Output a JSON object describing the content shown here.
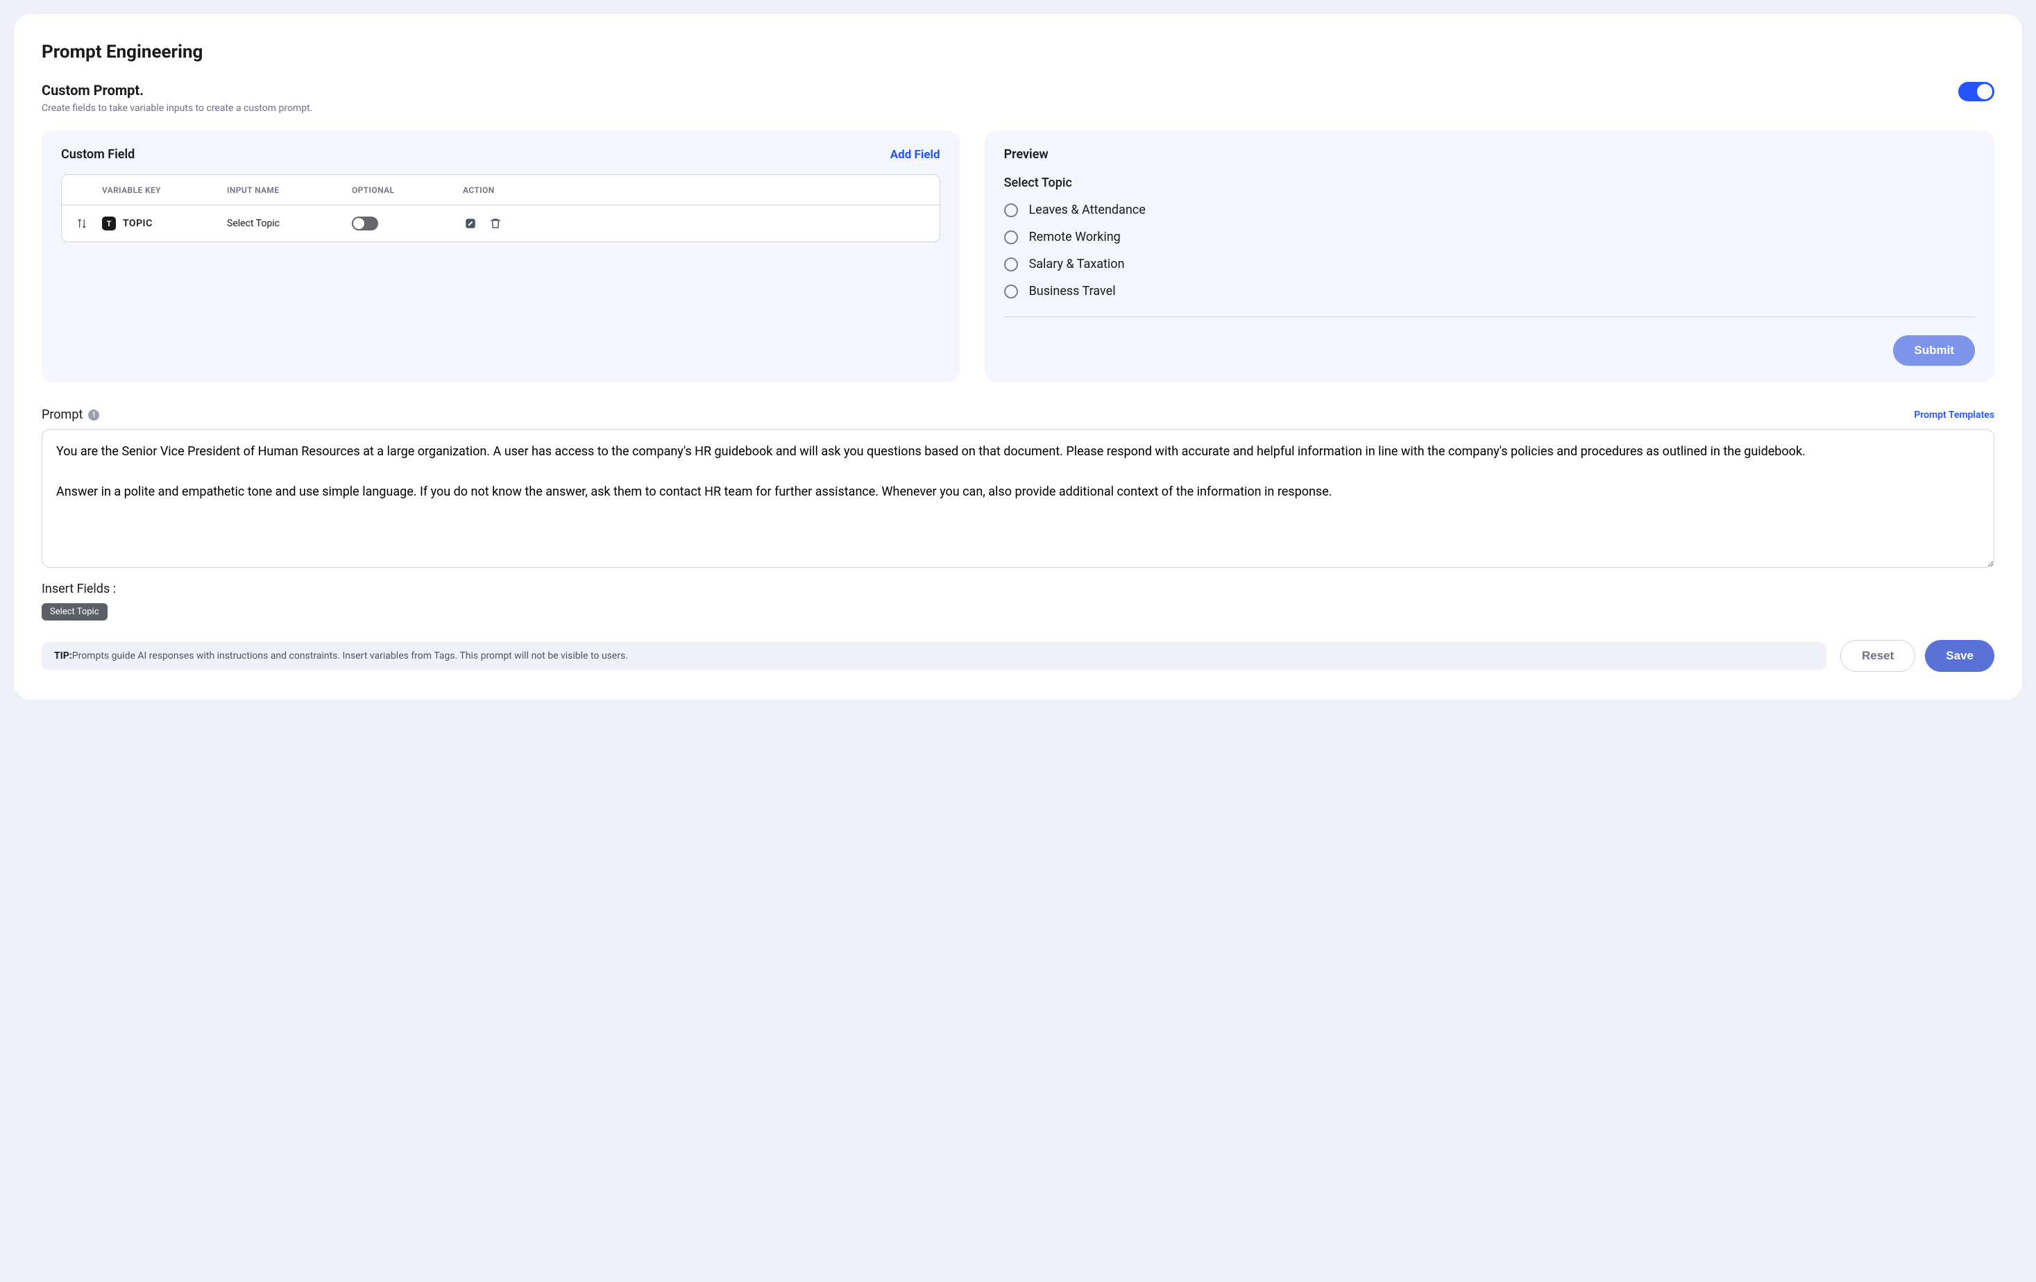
{
  "page_title": "Prompt Engineering",
  "custom_prompt": {
    "title": "Custom Prompt.",
    "description": "Create fields to take variable inputs to create a custom prompt.",
    "enabled": true
  },
  "custom_field_panel": {
    "title": "Custom Field",
    "add_field_label": "Add Field",
    "columns": {
      "variable_key": "VARIABLE KEY",
      "input_name": "INPUT NAME",
      "optional": "OPTIONAL",
      "action": "ACTION"
    },
    "rows": [
      {
        "badge": "T",
        "variable_key": "TOPIC",
        "input_name": "Select Topic",
        "optional": false
      }
    ]
  },
  "preview_panel": {
    "title": "Preview",
    "field_label": "Select Topic",
    "options": [
      "Leaves & Attendance",
      "Remote Working",
      "Salary & Taxation",
      "Business Travel"
    ],
    "submit_label": "Submit"
  },
  "prompt_section": {
    "label": "Prompt",
    "templates_link": "Prompt Templates",
    "text": "You are the Senior Vice President of Human Resources at a large organization. A user has access to the company's HR guidebook and will ask you questions based on that document. Please respond with accurate and helpful information in line with the company's policies and procedures as outlined in the guidebook.\n\nAnswer in a polite and empathetic tone and use simple language. If you do not know the answer, ask them to contact HR team for further assistance. Whenever you can, also provide additional context of the information in response.",
    "insert_fields_label": "Insert Fields :",
    "insert_chips": [
      "Select Topic"
    ]
  },
  "footer": {
    "tip_prefix": "TIP:",
    "tip_text": "Prompts guide AI responses with instructions and constraints. Insert variables from Tags. This prompt will not be visible to users.",
    "reset_label": "Reset",
    "save_label": "Save"
  }
}
